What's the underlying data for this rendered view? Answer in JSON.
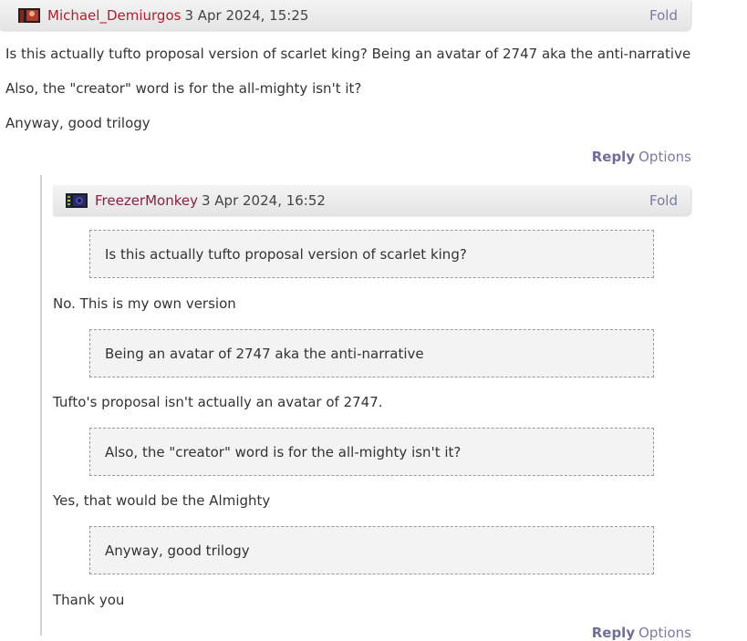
{
  "comments": [
    {
      "author": "Michael_Demiurgos",
      "date": "3 Apr 2024, 15:25",
      "fold_label": "Fold",
      "paragraphs": [
        "Is this actually tufto proposal version of scarlet king? Being an avatar of 2747 aka the anti-narrative",
        "Also, the \"creator\" word is for the all-mighty isn't it?",
        "Anyway, good trilogy"
      ],
      "reply_label": "Reply",
      "options_label": "Options"
    },
    {
      "author": "FreezerMonkey",
      "date": "3 Apr 2024, 16:52",
      "fold_label": "Fold",
      "blocks": [
        {
          "quote": "Is this actually tufto proposal version of scarlet king?",
          "answer": "No. This is my own version"
        },
        {
          "quote": "Being an avatar of 2747 aka the anti-narrative",
          "answer": "Tufto's proposal isn't actually an avatar of 2747."
        },
        {
          "quote": "Also, the \"creator\" word is for the all-mighty isn't it?",
          "answer": "Yes, that would be the Almighty"
        },
        {
          "quote": "Anyway, good trilogy",
          "answer": "Thank you"
        }
      ],
      "reply_label": "Reply",
      "options_label": "Options"
    }
  ],
  "icons": {
    "avatar_1": "avatar-red-figure",
    "avatar_2": "avatar-green-blue-monitor"
  }
}
